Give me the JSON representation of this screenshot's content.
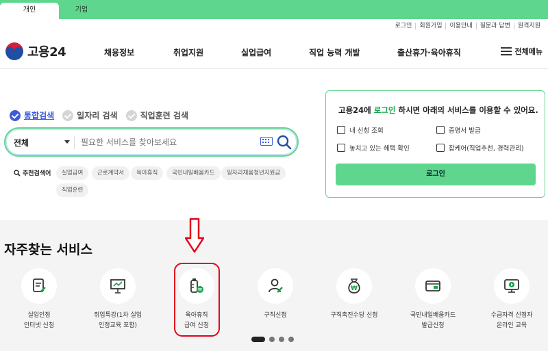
{
  "colors": {
    "brand_green": "#5fd68d",
    "accent_blue": "#3b5bdb",
    "annotation_red": "#e3001b"
  },
  "user_type_tabs": [
    {
      "label": "개인",
      "active": true
    },
    {
      "label": "기업",
      "active": false
    }
  ],
  "util_links": [
    "로그인",
    "회원가입",
    "이용안내",
    "질문과 답변",
    "원격지원"
  ],
  "logo": {
    "text": "고용24"
  },
  "gnb": [
    "채용정보",
    "취업지원",
    "실업급여",
    "직업 능력 개발",
    "출산휴가·육아휴직"
  ],
  "all_menu_label": "전체메뉴",
  "search": {
    "tabs": [
      {
        "label": "통합검색",
        "active": true
      },
      {
        "label": "일자리 검색",
        "active": false
      },
      {
        "label": "직업훈련 검색",
        "active": false
      }
    ],
    "scope": "전체",
    "placeholder": "필요한 서비스를 찾아보세요",
    "recommend_label": "추천검색어",
    "keywords": [
      "실업급여",
      "근로계약서",
      "육아휴직",
      "국민내일배움카드",
      "일자리채움청년지원금",
      "직업훈련"
    ]
  },
  "login_panel": {
    "title_pre": "고용24에 ",
    "title_em": "로그인",
    "title_post": " 하시면 아래의 서비스를 이용할 수 있어요.",
    "items": [
      "내 신청 조회",
      "증명서 발급",
      "놓치고 있는 혜택 확인",
      "잡케어(직업추천, 경력관리)"
    ],
    "button": "로그인"
  },
  "services": {
    "title": "자주찾는 서비스",
    "items": [
      {
        "label": "실업인정\n인터넷 신청",
        "icon": "document-pen-icon"
      },
      {
        "label": "취업특강(1차 실업\n인정교육 포함)",
        "icon": "presentation-board-icon"
      },
      {
        "label": "육아휴직\n급여 신청",
        "icon": "baby-bottle-icon"
      },
      {
        "label": "구직신청",
        "icon": "person-pen-icon"
      },
      {
        "label": "구직촉진수당 신청",
        "icon": "money-bag-icon"
      },
      {
        "label": "국민내일배움카드\n발급신청",
        "icon": "card-icon"
      },
      {
        "label": "수급자격 신청자\n온라인 교육",
        "icon": "video-play-icon"
      }
    ],
    "pages": 4,
    "current_page": 1
  }
}
